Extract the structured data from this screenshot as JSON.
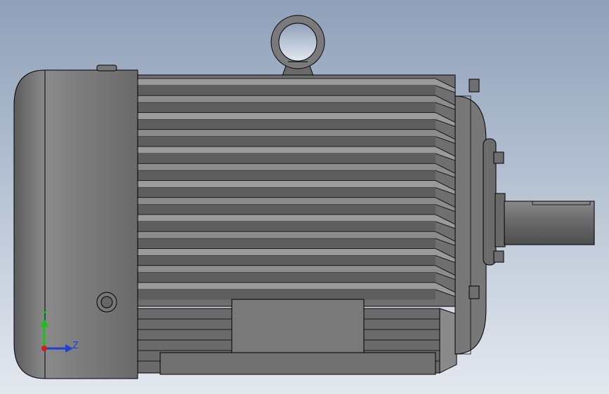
{
  "viewport": {
    "background_top": "#8fa0b9",
    "background_bottom": "#e3e8ef",
    "body_color": "#6f6f6f",
    "edge_color": "#000000"
  },
  "model": {
    "parts": [
      "lifting-eye",
      "end-cover",
      "finned-frame",
      "mounting-foot",
      "base-plate",
      "front-flange",
      "shaft",
      "terminal-boss"
    ],
    "fin_count": 13
  },
  "triad": {
    "y_label": "Y",
    "z_label": "Z",
    "y_color": "#16c21a",
    "z_color": "#1f3fd8",
    "x_color": "#d21b1b"
  }
}
